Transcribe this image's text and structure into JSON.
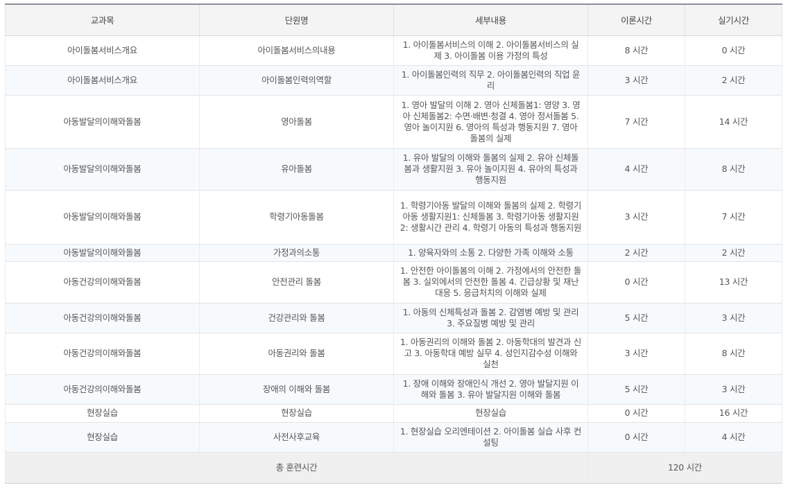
{
  "table": {
    "headers": [
      "교과목",
      "단원명",
      "세부내용",
      "이론시간",
      "실기시간"
    ],
    "rows": [
      {
        "subject": "아이돌봄서비스개요",
        "unit": "아이돌봄서비스의내용",
        "detail": "1. 아이돌봄서비스의 이해 2. 아이돌봄서비스의 실제 3. 아이돌봄 이용 가정의 특성",
        "theory": "8 시간",
        "practice": "0 시간"
      },
      {
        "subject": "아이돌봄서비스개요",
        "unit": "아이돌봄인력의역할",
        "detail": "1. 아이돌봄인력의 직무 2. 아이돌봄인력의 직업 윤리",
        "theory": "3 시간",
        "practice": "2 시간"
      },
      {
        "subject": "아동발달의이해와돌봄",
        "unit": "영아돌봄",
        "detail": "1. 영아 발달의 이해 2. 영아 신체돌봄1: 영양 3. 영아 신체돌봄2: 수면·배변·청결 4. 영아 정서돌봄 5. 영아 놀이지원 6. 영아의 특성과 행동지원 7. 영아 돌봄의 실제",
        "theory": "7 시간",
        "practice": "14 시간"
      },
      {
        "subject": "아동발달의이해와돌봄",
        "unit": "유아돌봄",
        "detail": "1. 유아 발달의 이해와 돌봄의 실제 2. 유아 신체돌봄과 생활지원 3. 유아 놀이지원 4. 유아의 특성과 행동지원",
        "theory": "4 시간",
        "practice": "8 시간"
      },
      {
        "subject": "아동발달의이해와돌봄",
        "unit": "학령기아동돌봄",
        "detail": "1. 학령기아동 발달의 이해와 돌봄의 실제 2. 학령기아동 생활지원1: 신체돌봄 3. 학령기아동 생활지원2: 생활시간 관리 4. 학령기 아동의 특성과 행동지원",
        "theory": "3 시간",
        "practice": "7 시간"
      },
      {
        "subject": "아동발달의이해와돌봄",
        "unit": "가정과의소통",
        "detail": "1. 양육자와의 소통 2. 다양한 가족 이해와 소통",
        "theory": "2 시간",
        "practice": "2 시간"
      },
      {
        "subject": "아동건강의이해와돌봄",
        "unit": "안전관리 돌봄",
        "detail": "1. 안전한 아이돌봄의 이해 2. 가정에서의 안전한 돌봄 3. 실외에서의 안전한 돌봄 4. 긴급상황 및 재난 대응 5. 응급처치의 이해와 실제",
        "theory": "0 시간",
        "practice": "13 시간"
      },
      {
        "subject": "아동건강의이해와돌봄",
        "unit": "건강관리와 돌봄",
        "detail": "1. 아동의 신체특성과 돌봄 2. 감염병 예방 및 관리 3. 주요질병 예방 및 관리",
        "theory": "5 시간",
        "practice": "3 시간"
      },
      {
        "subject": "아동건강의이해와돌봄",
        "unit": "아동권리와 돌봄",
        "detail": "1. 아동권리의 이해와 돌봄 2. 아동학대의 발견과 신고 3. 아동학대 예방 실무 4. 성인지감수성 이해와 실천",
        "theory": "3 시간",
        "practice": "8 시간"
      },
      {
        "subject": "아동건강의이해와돌봄",
        "unit": "장애의 이해와 돌봄",
        "detail": "1. 장애 이해와 장애인식 개선 2. 영아 발달지원 이해와 돌봄 3. 유아 발달지원 이해와 돌봄",
        "theory": "5 시간",
        "practice": "3 시간"
      },
      {
        "subject": "현장실습",
        "unit": "현장실습",
        "detail": "현장실습",
        "theory": "0 시간",
        "practice": "16 시간"
      },
      {
        "subject": "현장실습",
        "unit": "사전사후교육",
        "detail": "1. 현장실습 오리엔테이션 2. 아이돌봄 실습 사후 컨설팅",
        "theory": "0 시간",
        "practice": "4 시간"
      }
    ],
    "total": {
      "label": "총 훈련시간",
      "value": "120 시간"
    }
  }
}
